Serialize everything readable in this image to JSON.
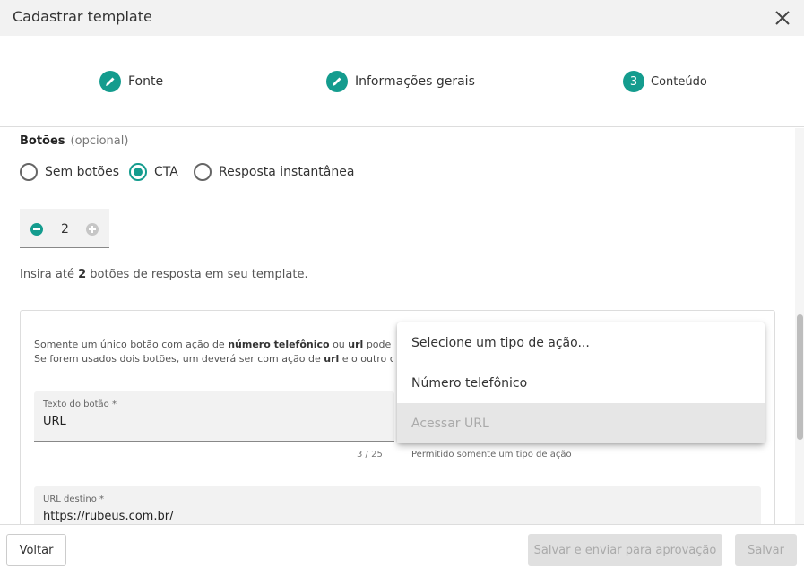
{
  "dialog": {
    "title": "Cadastrar template"
  },
  "steps": [
    {
      "label": "Fonte",
      "state": "done",
      "icon": "pencil-icon"
    },
    {
      "label": "Informações gerais",
      "state": "done",
      "icon": "pencil-icon"
    },
    {
      "label": "Conteúdo",
      "state": "active",
      "number": "3"
    }
  ],
  "buttons_section": {
    "title": "Botões",
    "optional": "(opcional)",
    "options": [
      "Sem botões",
      "CTA",
      "Resposta instantânea"
    ],
    "selected": "CTA",
    "count": "2",
    "hint_prefix": "Insira até",
    "hint_count": "2",
    "hint_suffix": "botões de resposta em seu template."
  },
  "card": {
    "note_line1_a": "Somente um único botão com ação de",
    "note_line1_b": "número telefônico",
    "note_line1_c": "ou",
    "note_line1_d": "url",
    "note_line1_e": "pode ser",
    "note_line2_a": "Se forem usados dois botões, um deverá ser com ação de",
    "note_line2_b": "url",
    "note_line2_c": "e o outro com",
    "button_text": {
      "label": "Texto do botão *",
      "value": "URL",
      "counter": "3 / 25"
    },
    "action_helper": "Permitido somente um tipo de ação",
    "url_field": {
      "label": "URL destino *",
      "value": "https://rubeus.com.br/"
    }
  },
  "dropdown": {
    "items": [
      {
        "label": "Selecione um tipo de ação...",
        "disabled": false
      },
      {
        "label": "Número telefônico",
        "disabled": false
      },
      {
        "label": "Acessar URL",
        "disabled": true
      }
    ]
  },
  "footer": {
    "back": "Voltar",
    "save_submit": "Salvar e enviar para aprovação",
    "save": "Salvar"
  },
  "colors": {
    "accent": "#149c8e"
  }
}
